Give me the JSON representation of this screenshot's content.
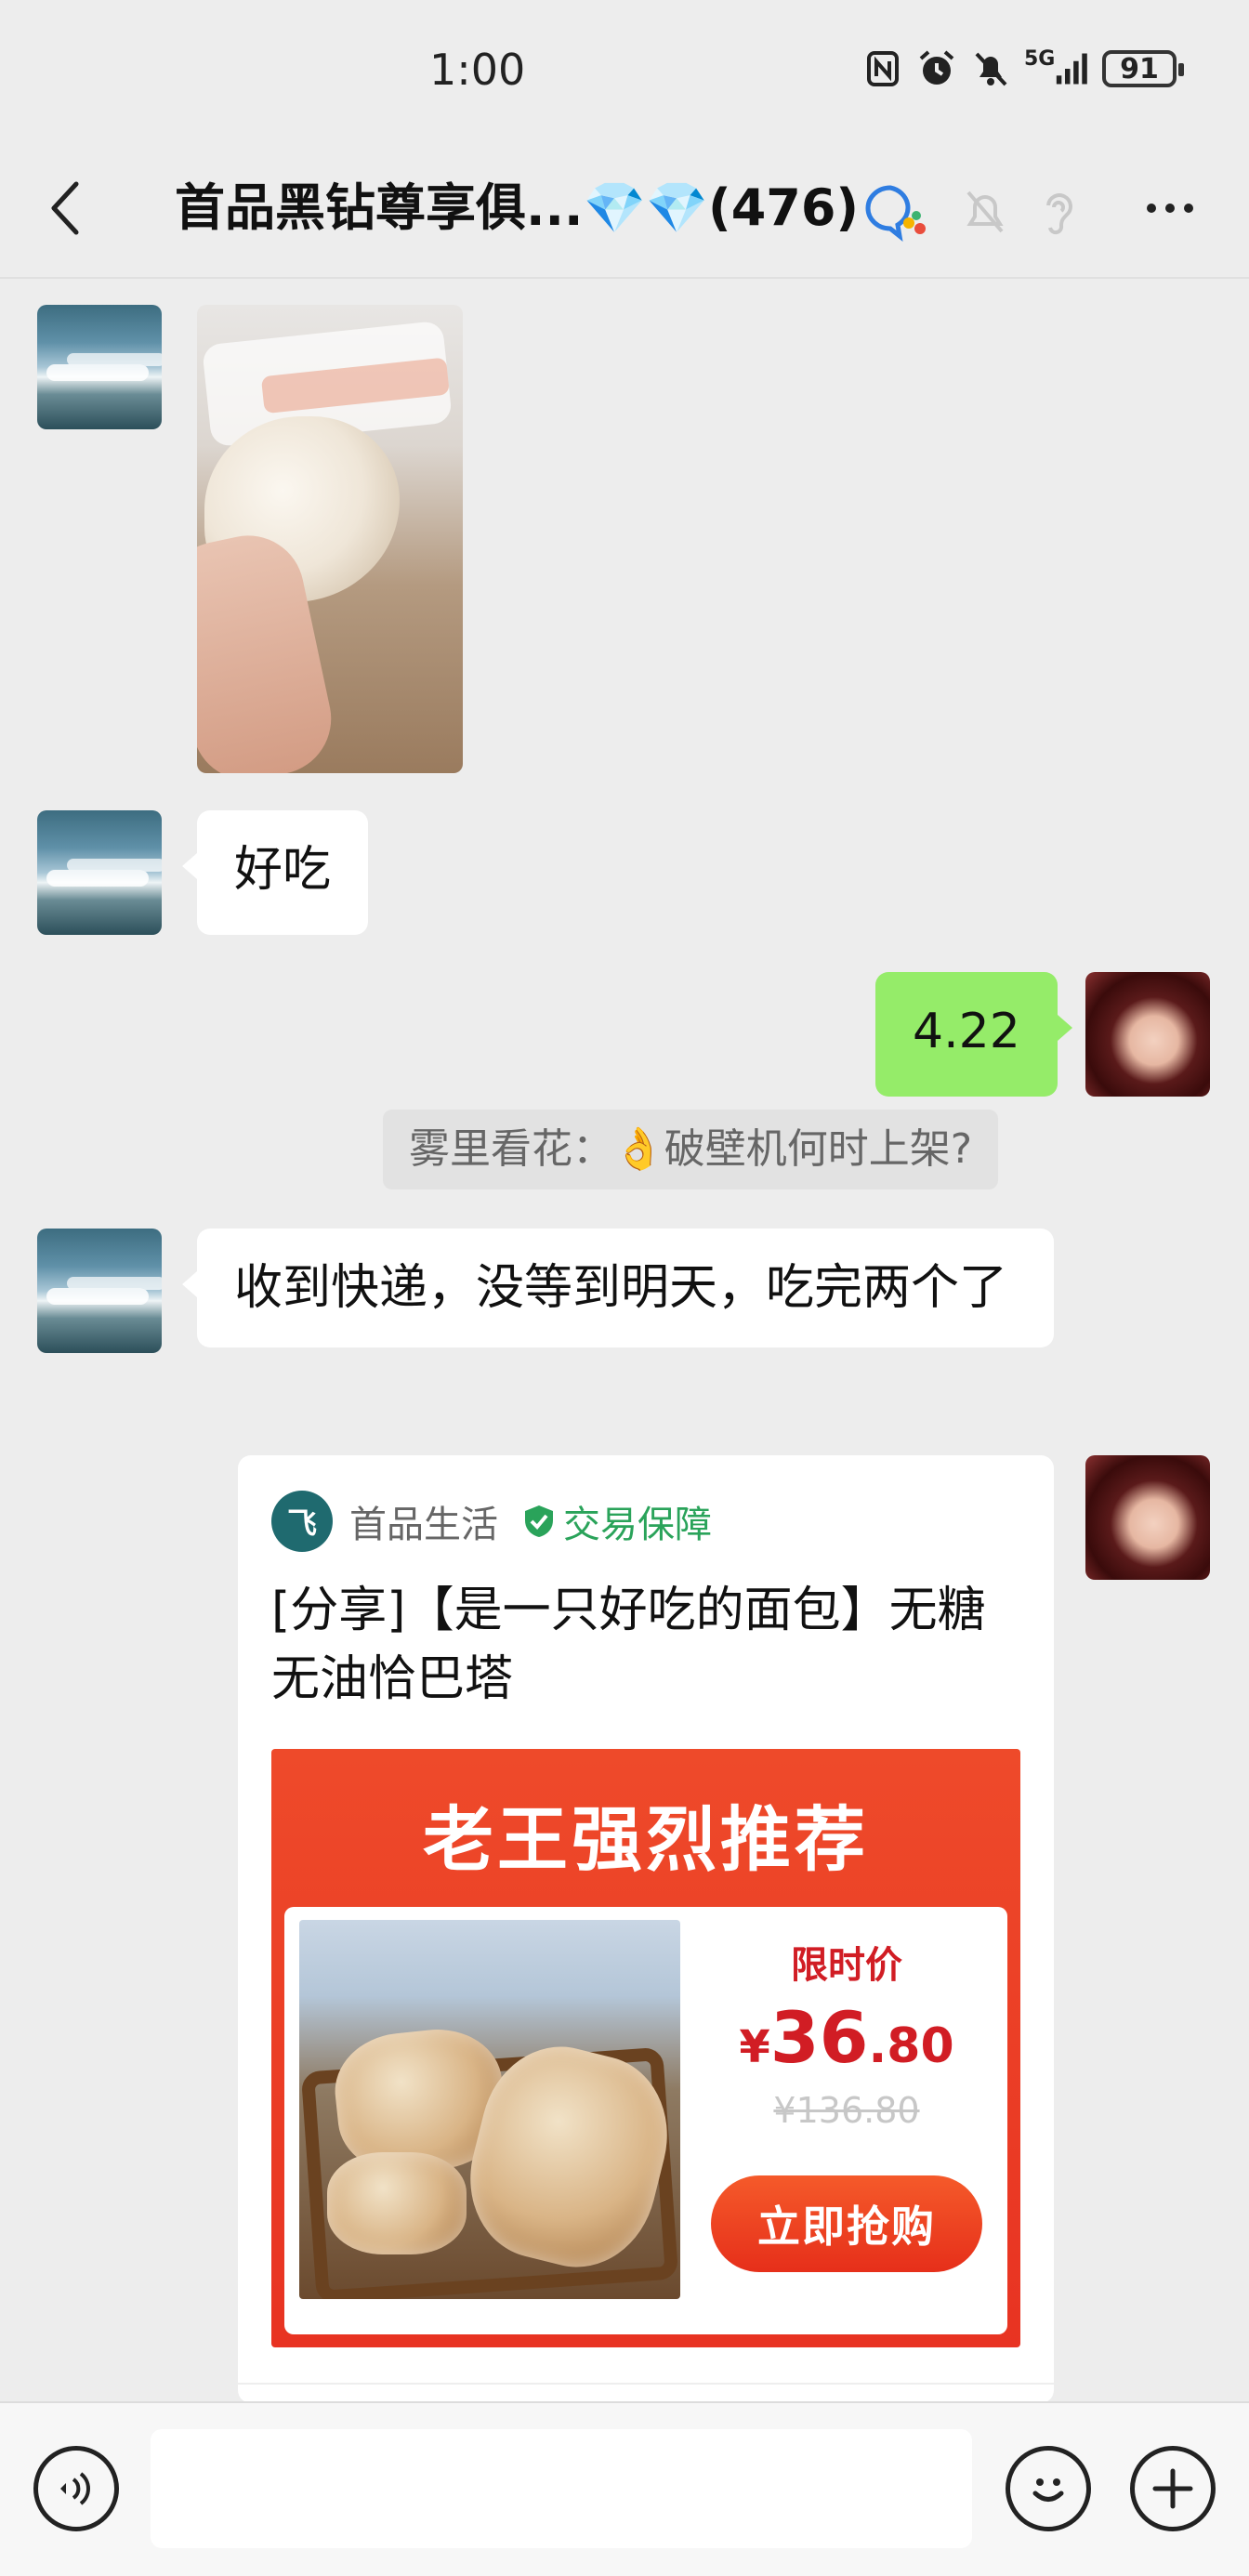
{
  "status": {
    "time": "1:00",
    "network": "5G",
    "battery": "91"
  },
  "header": {
    "title": "首品黑钻尊享俱...",
    "gems": "💎💎",
    "member_count": "(476)"
  },
  "messages": {
    "m2_text": "好吃",
    "m3_text": "4.22",
    "quote_text": "雾里看花：👌破壁机何时上架?",
    "m4_text": "收到快递，没等到明天，吃完两个了"
  },
  "share_card": {
    "logo_text": "飞",
    "shop_name": "首品生活",
    "guarantee": "交易保障",
    "title": "[分享]【是一只好吃的面包】无糖无油恰巴塔",
    "promo_heading": "老王强烈推荐",
    "limit_label": "限时价",
    "price_currency": "¥",
    "price_int": "36",
    "price_dec": ".80",
    "old_price": "¥136.80",
    "buy_label": "立即抢购"
  },
  "colors": {
    "self_bubble": "#95ec69",
    "accent_red": "#d11d24",
    "guarantee_green": "#2aa35a"
  }
}
